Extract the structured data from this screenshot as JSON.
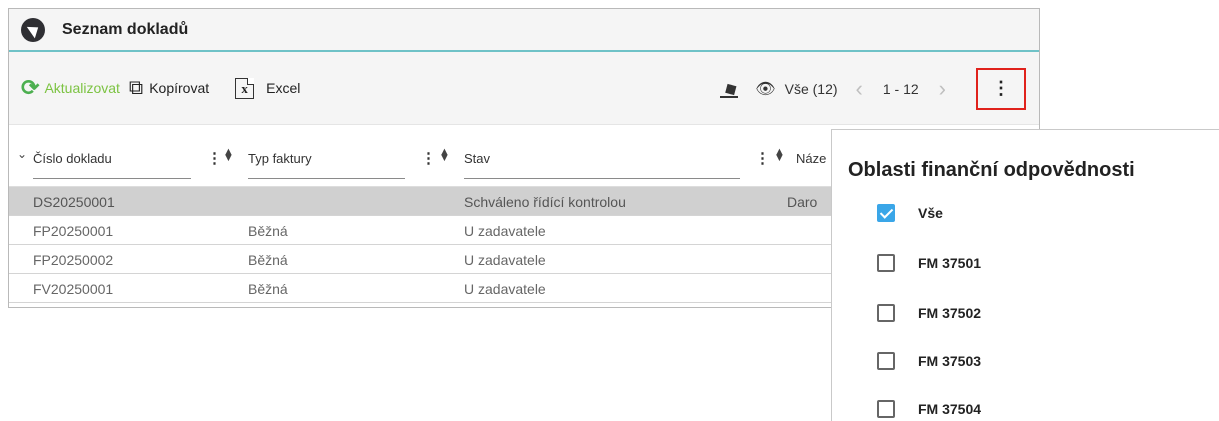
{
  "window": {
    "title": "Seznam dokladů"
  },
  "toolbar": {
    "refresh_label": "Aktualizovat",
    "copy_label": "Kopírovat",
    "excel_label": "Excel",
    "view_label": "Vše (12)",
    "page_range": "1 - 12"
  },
  "table": {
    "columns": [
      "Číslo dokladu",
      "Typ faktury",
      "Stav",
      "Náze"
    ],
    "rows": [
      {
        "cislo": "DS20250001",
        "typ": "",
        "stav": "Schváleno řídící kontrolou",
        "nazev": "Daro"
      },
      {
        "cislo": "FP20250001",
        "typ": "Běžná",
        "stav": "U zadavatele",
        "nazev": ""
      },
      {
        "cislo": "FP20250002",
        "typ": "Běžná",
        "stav": "U zadavatele",
        "nazev": ""
      },
      {
        "cislo": "FV20250001",
        "typ": "Běžná",
        "stav": "U zadavatele",
        "nazev": ""
      }
    ]
  },
  "popup": {
    "title": "Oblasti finanční odpovědnosti",
    "options": [
      {
        "label": "Vše",
        "checked": true
      },
      {
        "label": "FM 37501",
        "checked": false
      },
      {
        "label": "FM 37502",
        "checked": false
      },
      {
        "label": "FM 37503",
        "checked": false
      },
      {
        "label": "FM 37504",
        "checked": false
      }
    ]
  },
  "colors": {
    "accent_green": "#7cc342",
    "highlight_red": "#e0221c",
    "checkbox_blue": "#3aa6e8",
    "title_underline": "#6fc2c7"
  }
}
